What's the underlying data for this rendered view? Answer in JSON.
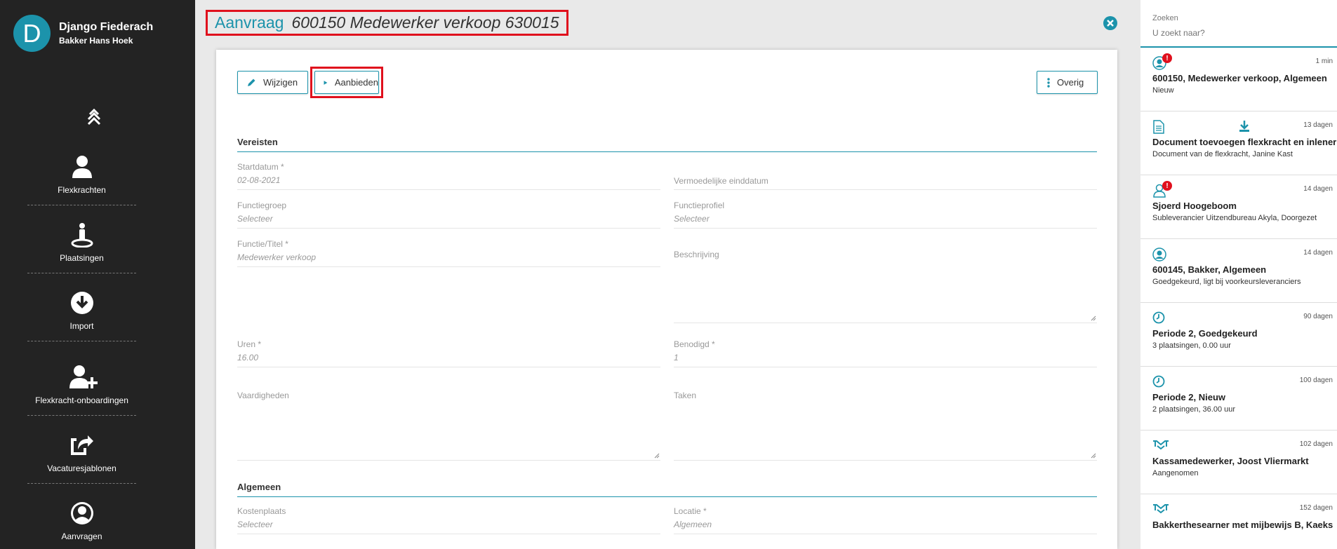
{
  "user": {
    "initial": "D",
    "name": "Django Fiederach",
    "company": "Bakker Hans Hoek"
  },
  "nav": [
    {
      "label": "Flexkrachten",
      "icon": "person-icon"
    },
    {
      "label": "Plaatsingen",
      "icon": "placement-icon"
    },
    {
      "label": "Import",
      "icon": "import-icon"
    },
    {
      "label": "Flexkracht-onboardingen",
      "icon": "user-add-icon"
    },
    {
      "label": "Vacaturesjablonen",
      "icon": "share-icon"
    },
    {
      "label": "Aanvragen",
      "icon": "user-circle-icon"
    }
  ],
  "header": {
    "title_prefix": "Aanvraag",
    "title_detail": "600150 Medewerker verkoop 630015"
  },
  "toolbar": {
    "edit_label": "Wijzigen",
    "offer_label": "Aanbieden",
    "more_label": "Overig"
  },
  "form": {
    "section_requirements": "Vereisten",
    "section_general": "Algemeen",
    "startdatum": {
      "label": "Startdatum *",
      "value": "02-08-2021"
    },
    "einddatum": {
      "label": "Vermoedelijke einddatum",
      "value": ""
    },
    "functiegroep": {
      "label": "Functiegroep",
      "value": "Selecteer"
    },
    "functieprofiel": {
      "label": "Functieprofiel",
      "value": "Selecteer"
    },
    "functie": {
      "label": "Functie/Titel *",
      "value": "Medewerker verkoop"
    },
    "beschrijving": {
      "label": "Beschrijving",
      "value": ""
    },
    "uren": {
      "label": "Uren *",
      "value": "16.00"
    },
    "benodigd": {
      "label": "Benodigd *",
      "value": "1"
    },
    "vaardigheden": {
      "label": "Vaardigheden",
      "value": ""
    },
    "taken": {
      "label": "Taken",
      "value": ""
    },
    "kostenplaats": {
      "label": "Kostenplaats",
      "value": "Selecteer"
    },
    "locatie": {
      "label": "Locatie *",
      "value": "Algemeen"
    }
  },
  "search": {
    "label": "Zoeken",
    "placeholder": "U zoekt naar?"
  },
  "notifications": [
    {
      "icon": "user-circle-icon",
      "badge": "!",
      "time": "1 min",
      "title": "600150, Medewerker verkoop, Algemeen",
      "sub": "Nieuw"
    },
    {
      "icon": "document-icon",
      "extra_icon": "download-icon",
      "time": "13 dagen",
      "title": "Document toevoegen flexkracht en inlener",
      "sub": "Document van de flexkracht, Janine Kast"
    },
    {
      "icon": "person-outline-icon",
      "badge": "!",
      "time": "14 dagen",
      "title": "Sjoerd Hoogeboom",
      "sub": "Subleverancier Uitzendbureau Akyla, Doorgezet"
    },
    {
      "icon": "user-circle-icon",
      "time": "14 dagen",
      "title": "600145, Bakker, Algemeen",
      "sub": "Goedgekeurd, ligt bij voorkeursleveranciers"
    },
    {
      "icon": "clock-icon",
      "time": "90 dagen",
      "title": "Periode 2, Goedgekeurd",
      "sub": "3 plaatsingen, 0.00 uur"
    },
    {
      "icon": "clock-icon",
      "time": "100 dagen",
      "title": "Periode 2, Nieuw",
      "sub": "2 plaatsingen, 36.00 uur"
    },
    {
      "icon": "handshake-icon",
      "time": "102 dagen",
      "title": "Kassamedewerker, Joost Vliermarkt",
      "sub": "Aangenomen"
    },
    {
      "icon": "handshake-icon",
      "time": "152 dagen",
      "title": "Bakkerthesearner met mijbewijs B, Kaeks",
      "sub": ""
    }
  ],
  "colors": {
    "accent": "#1c93ab",
    "sidebar": "#232323",
    "highlight": "#e0101d"
  }
}
